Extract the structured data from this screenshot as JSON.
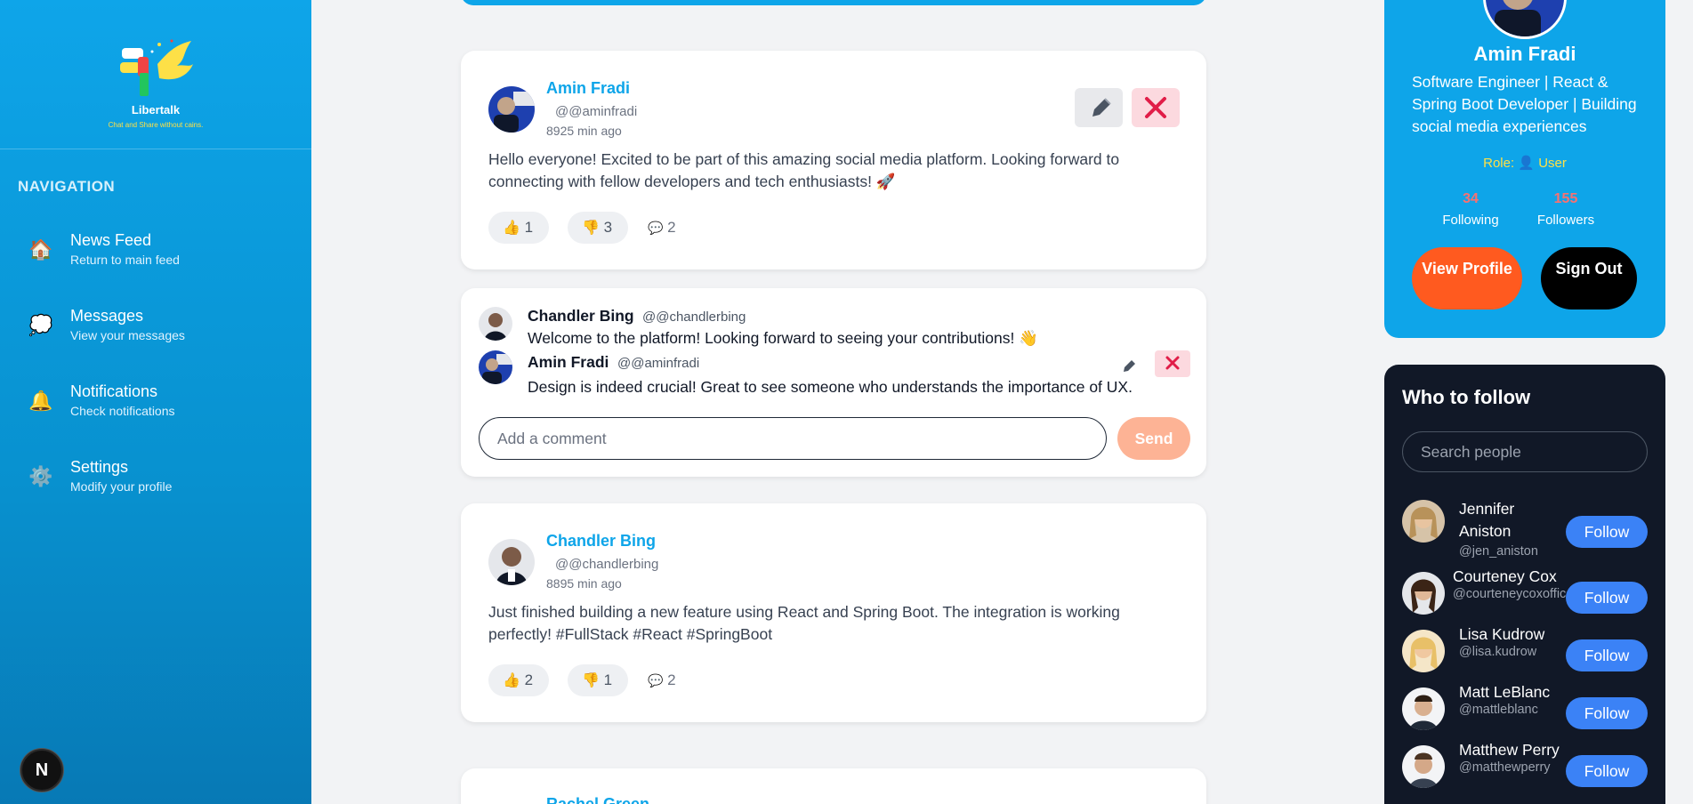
{
  "app": {
    "name": "Libertalk",
    "tagline": "Chat and Share without cains."
  },
  "sidebar": {
    "heading": "NAVIGATION",
    "items": [
      {
        "title": "News Feed",
        "subtitle": "Return to main feed",
        "icon": "house-icon"
      },
      {
        "title": "Messages",
        "subtitle": "View your messages",
        "icon": "speech-bubble-icon"
      },
      {
        "title": "Notifications",
        "subtitle": "Check notifications",
        "icon": "bell-icon"
      },
      {
        "title": "Settings",
        "subtitle": "Modify your profile",
        "icon": "gear-icon"
      }
    ],
    "badge": "N"
  },
  "feed": {
    "posts": [
      {
        "author": "Amin Fradi",
        "handle": "@@aminfradi",
        "time": "8925 min ago",
        "text": "Hello everyone! Excited to be part of this amazing social media platform. Looking forward to connecting with fellow developers and tech enthusiasts! 🚀",
        "likes": "1",
        "dislikes": "3",
        "comments": "2"
      },
      {
        "author": "Chandler Bing",
        "handle": "@@chandlerbing",
        "time": "8895 min ago",
        "text": "Just finished building a new feature using React and Spring Boot. The integration is working perfectly! #FullStack #React #SpringBoot",
        "likes": "2",
        "dislikes": "1",
        "comments": "2"
      },
      {
        "author": "Rachel Green"
      }
    ],
    "comments": [
      {
        "author": "Chandler Bing",
        "handle": "@@chandlerbing",
        "text": "Welcome to the platform! Looking forward to seeing your contributions! 👋"
      },
      {
        "author": "Amin Fradi",
        "handle": "@@aminfradi",
        "text": "Design is indeed crucial! Great to see someone who understands the importance of UX."
      }
    ],
    "comment_placeholder": "Add a comment",
    "send_label": "Send"
  },
  "profile": {
    "name": "Amin Fradi",
    "bio": "Software Engineer | React & Spring Boot Developer | Building social media experiences",
    "role_label": "Role:",
    "role_value": "User",
    "following_count": "34",
    "following_label": "Following",
    "followers_count": "155",
    "followers_label": "Followers",
    "view_profile_label": "View Profile",
    "sign_out_label": "Sign Out"
  },
  "who_to_follow": {
    "title": "Who to follow",
    "search_placeholder": "Search people",
    "follow_label": "Follow",
    "people": [
      {
        "name": "Jennifer Aniston",
        "handle": "@jen_aniston"
      },
      {
        "name": "Courteney Cox",
        "handle": "@courteneycoxofficial"
      },
      {
        "name": "Lisa Kudrow",
        "handle": "@lisa.kudrow"
      },
      {
        "name": "Matt LeBlanc",
        "handle": "@mattleblanc"
      },
      {
        "name": "Matthew Perry",
        "handle": "@matthewperry"
      }
    ]
  },
  "colors": {
    "accent": "#0ea5e9",
    "orange": "#ff5a1f",
    "follow_blue": "#3b82f6",
    "dark_card": "#111827"
  }
}
